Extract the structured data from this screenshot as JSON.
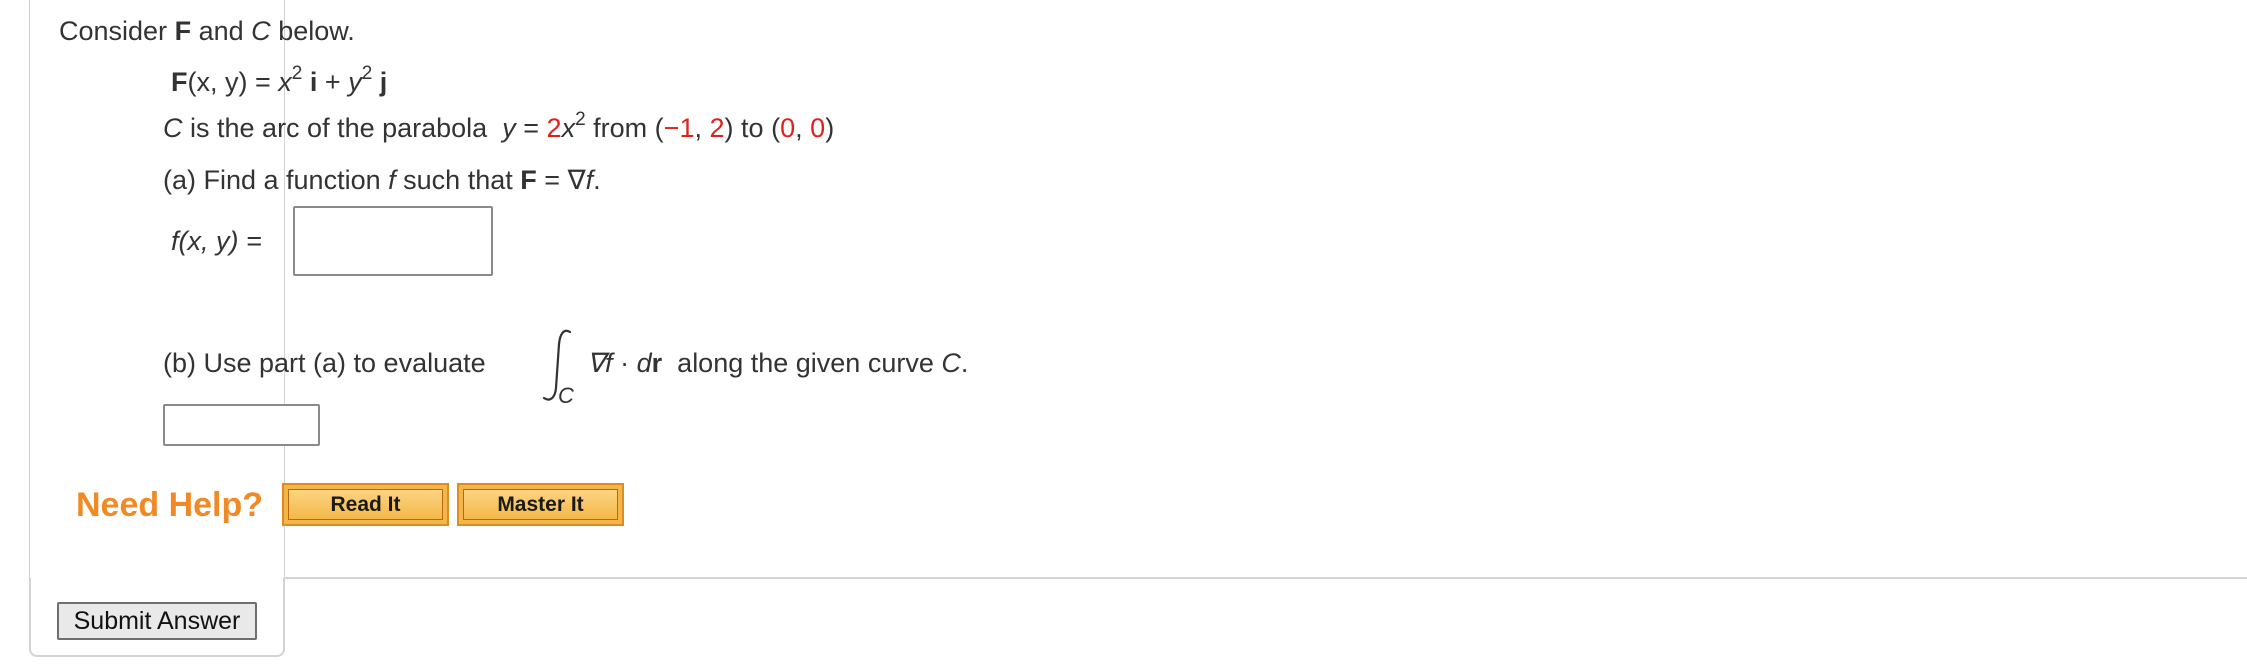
{
  "intro": {
    "consider": "Consider",
    "F": "F",
    "and": "and",
    "C": "C",
    "below": "below."
  },
  "field": {
    "F": "F",
    "args": "(x, y) =",
    "x": "x",
    "exp1": "2",
    "i": "i",
    "plus": "+",
    "y": "y",
    "exp2": "2",
    "j": "j"
  },
  "curve": {
    "C": "C",
    "text1": "is the arc of the parabola",
    "y": "y",
    "eq": "=",
    "coef": "2",
    "x": "x",
    "exp": "2",
    "from": "from",
    "p1_open": "(",
    "p1_x": "−1",
    "comma1": ",",
    "p1_y": "2",
    "p1_close": ")",
    "to": "to",
    "p2_open": "(",
    "p2_x": "0",
    "comma2": ",",
    "p2_y": "0",
    "p2_close": ")"
  },
  "part_a": {
    "prefix": "(a) Find a function",
    "f": "f",
    "such": "such that",
    "F": "F",
    "eq": "=",
    "nabla": "∇",
    "f2": "f",
    "period": ".",
    "label": "f(x, y) ="
  },
  "part_b": {
    "prefix": "(b) Use part (a) to evaluate",
    "sub_C": "C",
    "nabla_f": "∇f",
    "dot": "·",
    "d": "d",
    "r": "r",
    "suffix": "along the given curve",
    "C": "C",
    "period": "."
  },
  "help": {
    "label": "Need Help?",
    "read_it": "Read It",
    "master_it": "Master It"
  },
  "submit": {
    "label": "Submit Answer"
  },
  "answers": {
    "a_value": "",
    "b_value": ""
  },
  "colors": {
    "highlight": "#e0221c",
    "help": "#f08a24"
  }
}
